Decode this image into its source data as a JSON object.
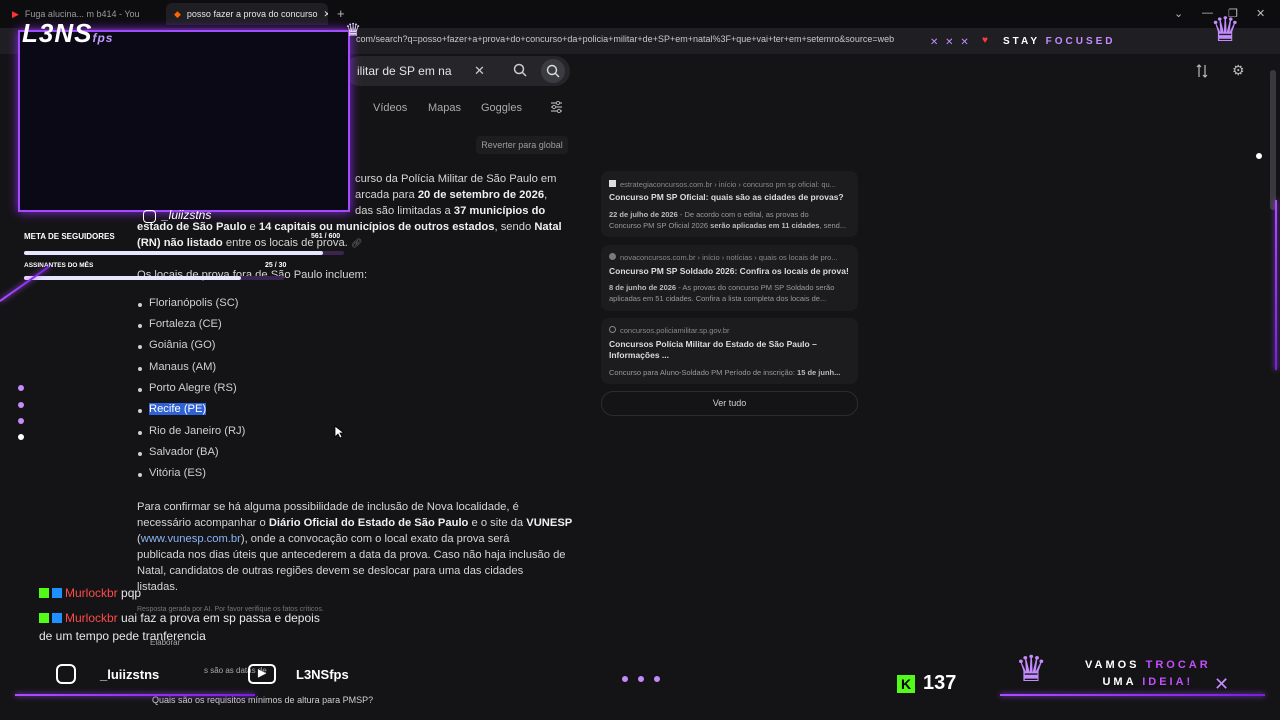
{
  "browser": {
    "tabs": [
      {
        "label": "Fuga alucina... m b414 - You"
      },
      {
        "label": "posso fazer a prova do concurso"
      }
    ],
    "new_tab": "+",
    "url": "com/search?q=posso+fazer+a+prova+do+concurso+da+policia+militar+de+SP+em+natal%3F+que+vai+ter+em+setemro&source=web",
    "window_controls": [
      "⌄",
      "—",
      "❐",
      "✕"
    ]
  },
  "search": {
    "query": "ilitar de SP em na",
    "nav": [
      "Vídeos",
      "Mapas",
      "Goggles"
    ],
    "revert_label": "Reverter para global"
  },
  "answer": {
    "intro_line1": "curso da Polícia Militar de São Paulo em",
    "intro_line2_pre": "arcada para ",
    "intro_line2_bold": "20 de setembro de 2026",
    "intro_line3_pre": "das são limitadas a ",
    "intro_line3_bold": "37 municípios do",
    "intro_line4_bold": "estado de São Paulo",
    "intro_line4_mid": " e ",
    "intro_line4_bold2": "14 capitais ou municípios de outros estados",
    "intro_line4_post": ", sendo ",
    "intro_line4_bold3": "Natal",
    "intro_line5_bold": "(RN) não listado",
    "intro_line5_post": " entre os locais de prova.",
    "list_heading": "Os locais de prova fora de São Paulo incluem:",
    "cities": [
      "Florianópolis (SC)",
      "Fortaleza (CE)",
      "Goiânia (GO)",
      "Manaus (AM)",
      "Porto Alegre (RS)",
      "Recife (PE)",
      "Rio de Janeiro (RJ)",
      "Salvador (BA)",
      "Vitória (ES)"
    ],
    "p2_l1": "Para confirmar se há alguma possibilidade de inclusão de Nova localidade, é",
    "p2_l2_pre": "necessário acompanhar o ",
    "p2_l2_b1": "Diário Oficial do Estado de São Paulo",
    "p2_l2_mid": " e o site da ",
    "p2_l2_b2": "VUNESP",
    "p2_l3_link": "www.vunesp.com.br",
    "p2_l3_post": "), onde a convocação com o local exato da prova será",
    "p2_l4": "publicada nos dias úteis que antecederem a data da prova. Caso não haja inclusão de",
    "p2_l5": "Natal, candidatos de outras regiões devem se deslocar para uma das cidades",
    "p2_l6": "listadas.",
    "disclaimer": "Resposta gerada por AI. Por favor verifique os fatos críticos.",
    "elaborate": "Elaborar",
    "followup_partial": "s são as datas de",
    "followup": "Quais são os requisitos mínimos de altura para PMSP?"
  },
  "sources": [
    {
      "domain": "estrategiaconcursos.com.br › início › concurso pm sp oficial: qu...",
      "title": "Concurso PM SP Oficial: quais são as cidades de provas?",
      "date": "22 de julho de 2026",
      "desc_pre": " - De acordo com o edital, as provas do",
      "desc2_pre": "Concurso PM SP Oficial 2026 ",
      "desc2_bold": "serão aplicadas em 11 cidades",
      "desc2_post": ", send..."
    },
    {
      "domain": "novaconcursos.com.br › início › notícias › quais os locais de pro...",
      "title": "Concurso PM SP Soldado 2026: Confira os locais de prova!",
      "date": "8 de junho de 2026",
      "desc_pre": " - As provas do concurso PM SP Soldado serão",
      "desc2_pre": "aplicadas em 51 cidades. Confira a lista completa dos locais de...",
      "desc2_bold": "",
      "desc2_post": ""
    },
    {
      "domain": "concursos.policiamilitar.sp.gov.br",
      "title": "Concursos Polícia Militar do Estado de São Paulo – Informações ...",
      "date": "",
      "desc_pre": "Concurso para Aluno-Soldado PM Período de inscrição: ",
      "desc2_pre": "",
      "desc2_bold": "15 de junh...",
      "desc2_post": ""
    }
  ],
  "see_all": "Ver tudo",
  "overlay": {
    "logo": "L3NS",
    "logo_suffix": "fps",
    "instagram_small": "_luiizstns",
    "goal_label": "META DE SEGUIDORES",
    "goal_value": "561 / 600",
    "goal_progress": 0.935,
    "subs_label": "ASSINANTES DO MÊS",
    "subs_value": "25 / 30",
    "subs_progress": 0.833,
    "stay_focused": "STAY FOCUSED",
    "stay_word1": "STAY",
    "stay_word2": "FOCUSED",
    "chat": [
      {
        "user": "Murlockbr",
        "message": "pqp"
      },
      {
        "user": "Murlockbr",
        "message": "uai faz a prova em sp passa e depois"
      },
      {
        "user": "",
        "message": "de um tempo pede tranferencia"
      }
    ],
    "instagram": "_luiizstns",
    "youtube": "L3NSfps",
    "kick_count": "137",
    "trocar_l1_a": "VAMOS",
    "trocar_l1_b": "TROCAR",
    "trocar_l2_a": "UMA",
    "trocar_l2_b": "IDEIA!",
    "colors": {
      "accent": "#a34cff",
      "user": "#ff4a4a",
      "kick": "#53fc18"
    }
  }
}
